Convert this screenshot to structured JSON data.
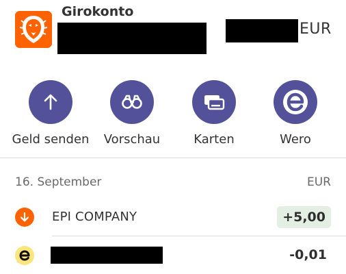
{
  "account": {
    "title": "Girokonto",
    "currency": "EUR"
  },
  "actions": [
    {
      "label": "Geld senden",
      "icon": "arrow-up-icon"
    },
    {
      "label": "Vorschau",
      "icon": "binoculars-icon"
    },
    {
      "label": "Karten",
      "icon": "cards-icon"
    },
    {
      "label": "Wero",
      "icon": "wero-logo-icon"
    }
  ],
  "transactions": {
    "date": "16. September",
    "currency_header": "EUR",
    "items": [
      {
        "name": "EPI COMPANY",
        "amount": "+5,00"
      },
      {
        "amount": "-0,01"
      }
    ]
  },
  "colors": {
    "brand": "#ff6200",
    "action_circle": "#525199",
    "credit_pill": "#e4efe4",
    "wero_yellow": "#fbe57d"
  }
}
